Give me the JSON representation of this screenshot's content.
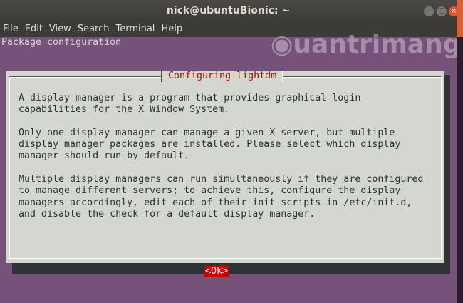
{
  "window": {
    "title": "nick@ubuntuBionic: ~"
  },
  "menu": [
    "File",
    "Edit",
    "View",
    "Search",
    "Terminal",
    "Help"
  ],
  "terminal": {
    "header": "Package configuration"
  },
  "dialog": {
    "title": "Configuring lightdm",
    "lines": [
      "A display manager is a program that provides graphical login",
      "capabilities for the X Window System.",
      "",
      "Only one display manager can manage a given X server, but multiple",
      "display manager packages are installed. Please select which display",
      "manager should run by default.",
      "",
      "Multiple display managers can run simultaneously if they are configured",
      "to manage different servers; to achieve this, configure the display",
      "managers accordingly, edit each of their init scripts in /etc/init.d,",
      "and disable the check for a default display manager."
    ],
    "ok_label": "<Ok>"
  },
  "watermark": "Quantrimang"
}
